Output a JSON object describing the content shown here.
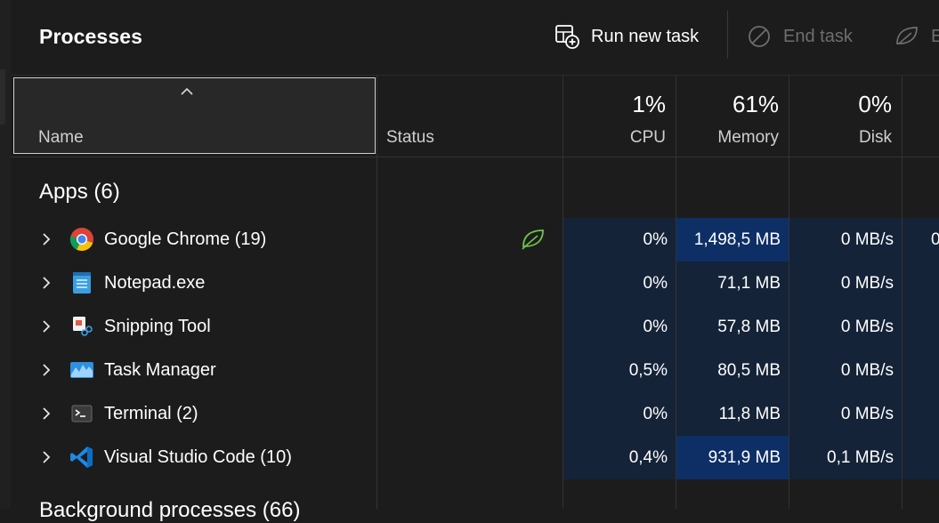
{
  "toolbar": {
    "title": "Processes",
    "run_new_task": "Run new task",
    "end_task": "End task",
    "efficiency_partial": "E"
  },
  "columns": {
    "name": "Name",
    "status": "Status",
    "cpu_pct": "1%",
    "cpu": "CPU",
    "memory_pct": "61%",
    "memory": "Memory",
    "disk_pct": "0%",
    "disk": "Disk"
  },
  "groups": {
    "apps": "Apps (6)",
    "background": "Background processes (66)"
  },
  "apps": [
    {
      "name": "Google Chrome (19)",
      "cpu": "0%",
      "memory": "1,498,5 MB",
      "disk": "0 MB/s",
      "network": "0",
      "icon": "chrome-icon",
      "efficiency": true,
      "mem_highlight": true
    },
    {
      "name": "Notepad.exe",
      "cpu": "0%",
      "memory": "71,1 MB",
      "disk": "0 MB/s",
      "network": "",
      "icon": "notepad-icon",
      "efficiency": false,
      "mem_highlight": false
    },
    {
      "name": "Snipping Tool",
      "cpu": "0%",
      "memory": "57,8 MB",
      "disk": "0 MB/s",
      "network": "",
      "icon": "snipping-tool-icon",
      "efficiency": false,
      "mem_highlight": false
    },
    {
      "name": "Task Manager",
      "cpu": "0,5%",
      "memory": "80,5 MB",
      "disk": "0 MB/s",
      "network": "",
      "icon": "task-manager-icon",
      "efficiency": false,
      "mem_highlight": false
    },
    {
      "name": "Terminal (2)",
      "cpu": "0%",
      "memory": "11,8 MB",
      "disk": "0 MB/s",
      "network": "",
      "icon": "terminal-icon",
      "efficiency": false,
      "mem_highlight": false
    },
    {
      "name": "Visual Studio Code (10)",
      "cpu": "0,4%",
      "memory": "931,9 MB",
      "disk": "0,1 MB/s",
      "network": "",
      "icon": "vscode-icon",
      "efficiency": false,
      "mem_highlight": true
    }
  ],
  "colors": {
    "background": "#1c1c1c",
    "heat_low": "#152338",
    "heat_high": "#0e2e66",
    "efficiency_green": "#6cc24a"
  }
}
